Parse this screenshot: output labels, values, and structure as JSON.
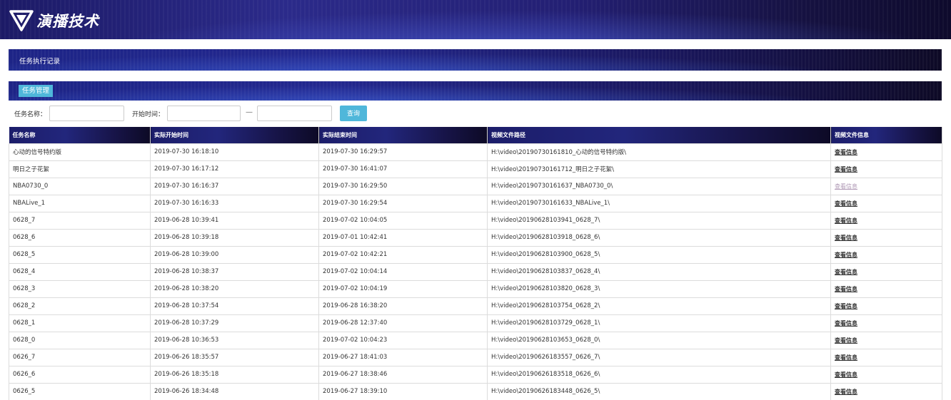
{
  "brand": {
    "name": "演播技术"
  },
  "section": {
    "title": "任务执行记录"
  },
  "tabs": {
    "active": "任务管理"
  },
  "search": {
    "task_name_label": "任务名称：",
    "task_name_value": "",
    "start_time_label": "开始时间：",
    "start_from_value": "",
    "range_separator": "—",
    "start_to_value": "",
    "query_button": "查询"
  },
  "table": {
    "headers": [
      "任务名称",
      "实际开始时间",
      "实际结束时间",
      "视频文件路径",
      "视频文件信息"
    ],
    "rows": [
      {
        "name": "心动的信号特约版",
        "start": "2019-07-30 16:18:10",
        "end": "2019-07-30 16:29:57",
        "path": "H:\\video\\20190730161810_心动的信号特约版\\",
        "action": "查看信息",
        "visited": false
      },
      {
        "name": "明日之子花絮",
        "start": "2019-07-30 16:17:12",
        "end": "2019-07-30 16:41:07",
        "path": "H:\\video\\20190730161712_明日之子花絮\\",
        "action": "查看信息",
        "visited": false
      },
      {
        "name": "NBA0730_0",
        "start": "2019-07-30 16:16:37",
        "end": "2019-07-30 16:29:50",
        "path": "H:\\video\\20190730161637_NBA0730_0\\",
        "action": "查看信息",
        "visited": true
      },
      {
        "name": "NBALive_1",
        "start": "2019-07-30 16:16:33",
        "end": "2019-07-30 16:29:54",
        "path": "H:\\video\\20190730161633_NBALive_1\\",
        "action": "查看信息",
        "visited": false
      },
      {
        "name": "0628_7",
        "start": "2019-06-28 10:39:41",
        "end": "2019-07-02 10:04:05",
        "path": "H:\\video\\20190628103941_0628_7\\",
        "action": "查看信息",
        "visited": false
      },
      {
        "name": "0628_6",
        "start": "2019-06-28 10:39:18",
        "end": "2019-07-01 10:42:41",
        "path": "H:\\video\\20190628103918_0628_6\\",
        "action": "查看信息",
        "visited": false
      },
      {
        "name": "0628_5",
        "start": "2019-06-28 10:39:00",
        "end": "2019-07-02 10:42:21",
        "path": "H:\\video\\20190628103900_0628_5\\",
        "action": "查看信息",
        "visited": false
      },
      {
        "name": "0628_4",
        "start": "2019-06-28 10:38:37",
        "end": "2019-07-02 10:04:14",
        "path": "H:\\video\\20190628103837_0628_4\\",
        "action": "查看信息",
        "visited": false
      },
      {
        "name": "0628_3",
        "start": "2019-06-28 10:38:20",
        "end": "2019-07-02 10:04:19",
        "path": "H:\\video\\20190628103820_0628_3\\",
        "action": "查看信息",
        "visited": false
      },
      {
        "name": "0628_2",
        "start": "2019-06-28 10:37:54",
        "end": "2019-06-28 16:38:20",
        "path": "H:\\video\\20190628103754_0628_2\\",
        "action": "查看信息",
        "visited": false
      },
      {
        "name": "0628_1",
        "start": "2019-06-28 10:37:29",
        "end": "2019-06-28 12:37:40",
        "path": "H:\\video\\20190628103729_0628_1\\",
        "action": "查看信息",
        "visited": false
      },
      {
        "name": "0628_0",
        "start": "2019-06-28 10:36:53",
        "end": "2019-07-02 10:04:23",
        "path": "H:\\video\\20190628103653_0628_0\\",
        "action": "查看信息",
        "visited": false
      },
      {
        "name": "0626_7",
        "start": "2019-06-26 18:35:57",
        "end": "2019-06-27 18:41:03",
        "path": "H:\\video\\20190626183557_0626_7\\",
        "action": "查看信息",
        "visited": false
      },
      {
        "name": "0626_6",
        "start": "2019-06-26 18:35:18",
        "end": "2019-06-27 18:38:46",
        "path": "H:\\video\\20190626183518_0626_6\\",
        "action": "查看信息",
        "visited": false
      },
      {
        "name": "0626_5",
        "start": "2019-06-26 18:34:48",
        "end": "2019-06-27 18:39:10",
        "path": "H:\\video\\20190626183448_0626_5\\",
        "action": "查看信息",
        "visited": false
      }
    ]
  },
  "colors": {
    "accent": "#4fb7da",
    "header_dark": "#1c1d6a",
    "visited_link": "#b09ab6"
  }
}
